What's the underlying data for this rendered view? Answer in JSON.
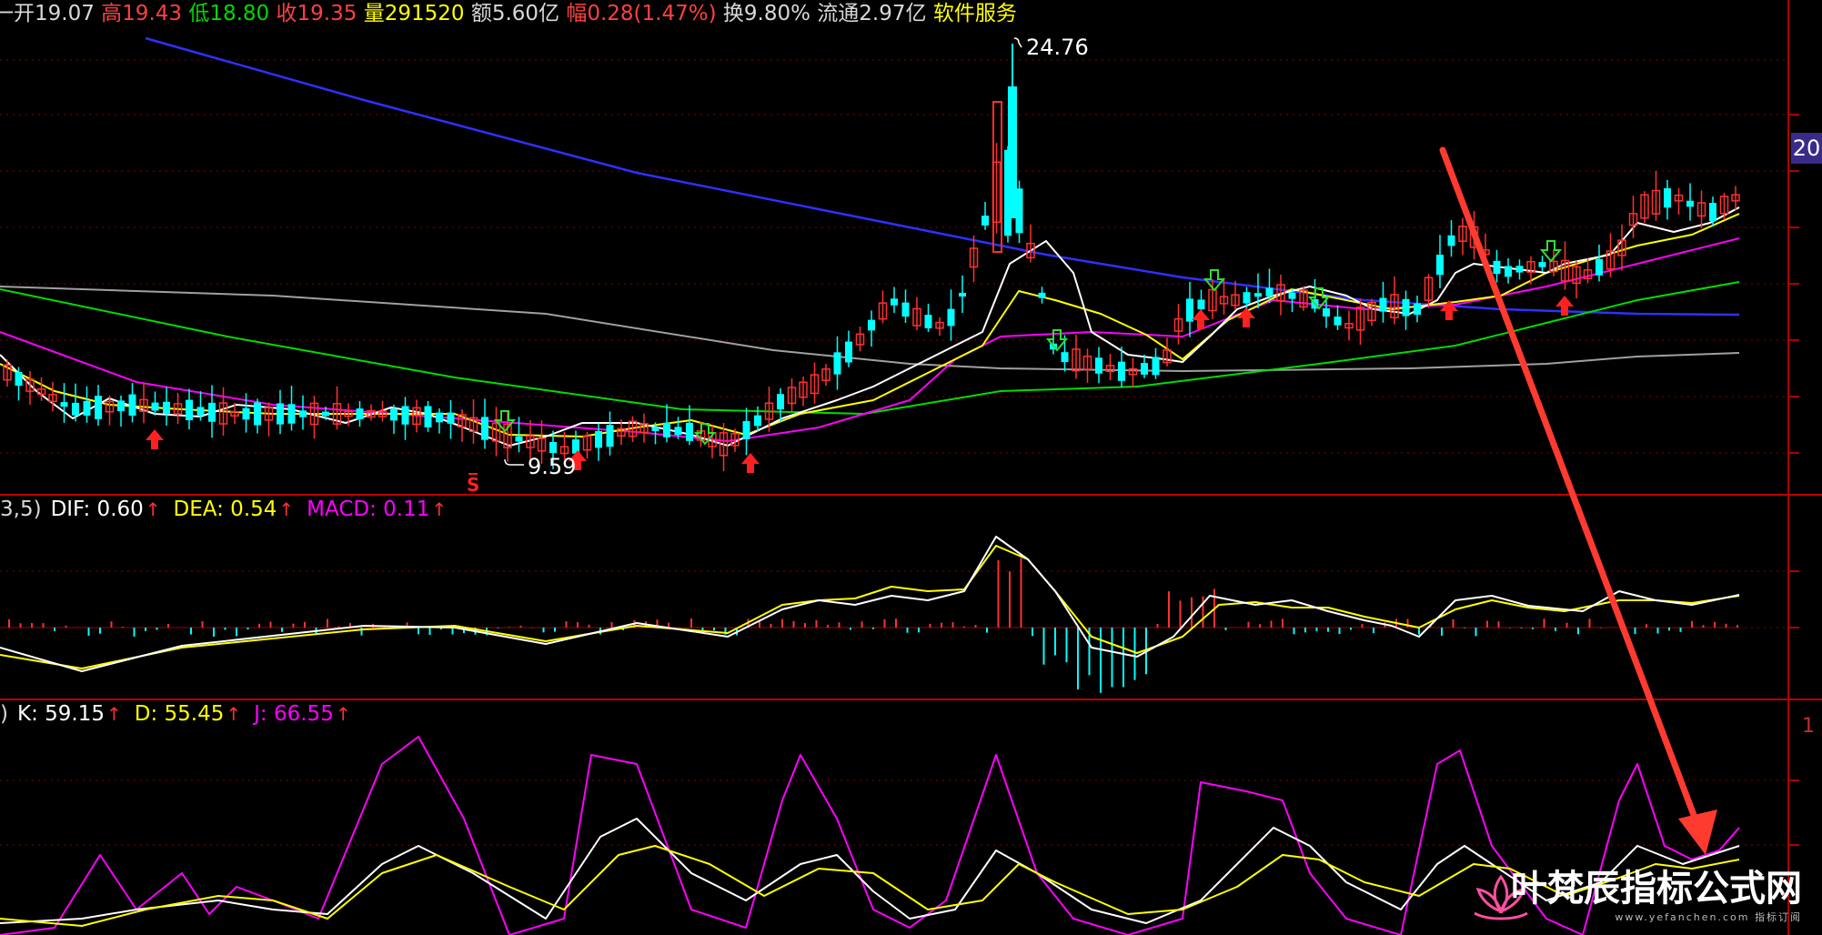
{
  "quote": {
    "open_label": "开",
    "open": "19.07",
    "high_label": "高",
    "high": "19.43",
    "low_label": "低",
    "low": "18.80",
    "close_label": "收",
    "close": "19.35",
    "volume_label": "量",
    "volume": "291520",
    "amount_label": "额",
    "amount": "5.60亿",
    "change_label": "幅",
    "change": "0.28(1.47%)",
    "turnover_label": "换",
    "turnover": "9.80%",
    "float_label": "流通",
    "float": "2.97亿",
    "sector": "软件服务"
  },
  "price_chart": {
    "high_marker": "24.76",
    "low_marker": "9.59",
    "right_axis_label": "20",
    "signal_s": "S"
  },
  "macd": {
    "params": "3,5)",
    "dif_label": "DIF: 0.60",
    "dea_label": "DEA: 0.54",
    "macd_label": "MACD: 0.11"
  },
  "kdj": {
    "params": ")",
    "k_label": "K: 59.15",
    "d_label": "D: 55.45",
    "j_label": "J: 66.55",
    "right_axis_label": "1"
  },
  "watermark": {
    "title": "叶梵辰指标公式网",
    "sub": "www.yefanchen.com  指标订阅"
  },
  "colors": {
    "background": "#000000",
    "grid": "#8a0000",
    "up_candle": "#ff3030",
    "down_candle": "#00ffff",
    "ma5": "#ffffff",
    "ma10": "#ffff00",
    "ma20": "#ff00ff",
    "ma60": "#00dd00",
    "ma120": "#3030ff",
    "ma250": "#a0a0a0",
    "kdj_k": "#ffffff",
    "kdj_d": "#ffff00",
    "kdj_j": "#ff00ff",
    "annotation_arrow": "#ff3b30"
  }
}
